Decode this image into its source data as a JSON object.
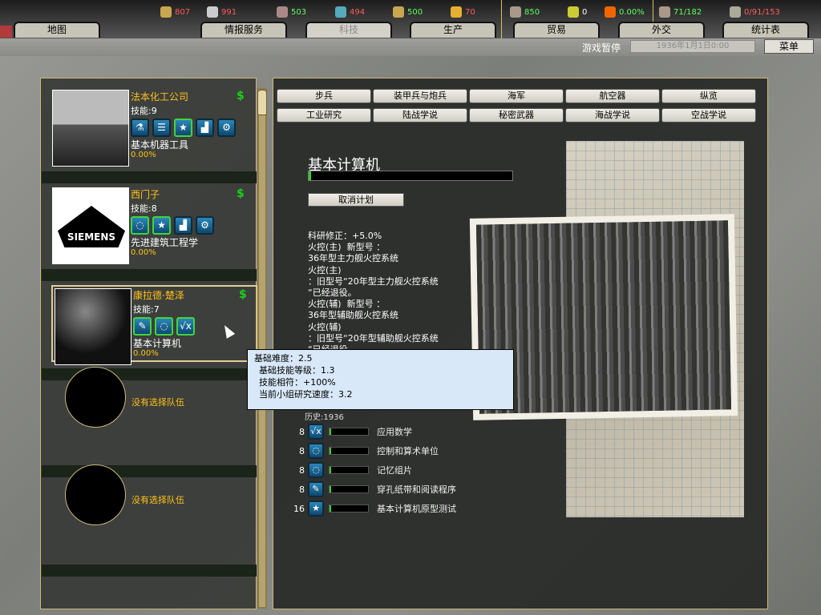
{
  "resources": [
    {
      "name": "energy",
      "value": "807",
      "color": "red"
    },
    {
      "name": "metal",
      "value": "991",
      "color": "red"
    },
    {
      "name": "rare-materials",
      "value": "503",
      "color": "green"
    },
    {
      "name": "oil",
      "value": "494",
      "color": "red"
    },
    {
      "name": "supplies",
      "value": "500",
      "color": "green"
    },
    {
      "name": "money",
      "value": "70",
      "color": "red"
    },
    {
      "name": "manpower",
      "value": "850",
      "color": "green"
    },
    {
      "name": "nuclear",
      "value": "0",
      "color": "white"
    },
    {
      "name": "dissent",
      "value": "0.00%",
      "color": "green"
    },
    {
      "name": "transport",
      "value": "71/182",
      "color": "green"
    },
    {
      "name": "divisions",
      "value": "0/91/153",
      "color": "red"
    }
  ],
  "tabs": [
    "地图",
    "情报服务",
    "科技",
    "生产",
    "贸易",
    "外交",
    "统计表"
  ],
  "active_tab": "科技",
  "status": {
    "paused": "游戏暂停",
    "date": "1936年1月1日0:00",
    "menu": "菜单"
  },
  "teams": [
    {
      "name": "法本化工公司",
      "skill": "技能:9",
      "project": "基本机器工具",
      "progress": "0.00%",
      "icons": [
        "flask",
        "database",
        "star",
        "factory",
        "gears"
      ]
    },
    {
      "name": "西门子",
      "skill": "技能:8",
      "project": "先进建筑工程学",
      "progress": "0.00%",
      "icons": [
        "bulb",
        "star",
        "factory",
        "gears"
      ],
      "logo": "SIEMENS"
    },
    {
      "name": "康拉德·楚泽",
      "skill": "技能:7",
      "project": "基本计算机",
      "progress": "0.00%",
      "icons": [
        "wrench",
        "bulb",
        "sqrt"
      ]
    }
  ],
  "empty_slot": "没有选择队伍",
  "categories_row1": [
    "步兵",
    "装甲兵与炮兵",
    "海军",
    "航空器",
    "纵览"
  ],
  "categories_row2": [
    "工业研究",
    "陆战学说",
    "秘密武器",
    "海战学说",
    "空战学说"
  ],
  "tech": {
    "title": "基本计算机",
    "progress": 0.01,
    "cancel": "取消计划",
    "description": [
      "科研修正：+5.0%",
      "火控(主)  新型号 ：",
      "36年型主力舰火控系统",
      "火控(主)",
      "：旧型号“20年型主力舰火控系统",
      "“已经退役。",
      "火控(辅)  新型号 ：",
      "36年型辅助舰火控系统",
      "火控(辅)",
      "：旧型号“20年型辅助舰火控系统",
      "“已经退役。"
    ],
    "history": "历史:1936",
    "components": [
      {
        "level": "8",
        "icon": "sqrt",
        "name": "应用数学"
      },
      {
        "level": "8",
        "icon": "bulb",
        "name": "控制和算术单位"
      },
      {
        "level": "8",
        "icon": "bulb",
        "name": "记忆组片"
      },
      {
        "level": "8",
        "icon": "wrench",
        "name": "穿孔纸带和阅读程序"
      },
      {
        "level": "16",
        "icon": "star",
        "name": "基本计算机原型测试"
      }
    ]
  },
  "tooltip": [
    "基础难度：2.5",
    "基础技能等级：1.3",
    "技能相符：+100%",
    "当前小组研究速度：3.2"
  ]
}
